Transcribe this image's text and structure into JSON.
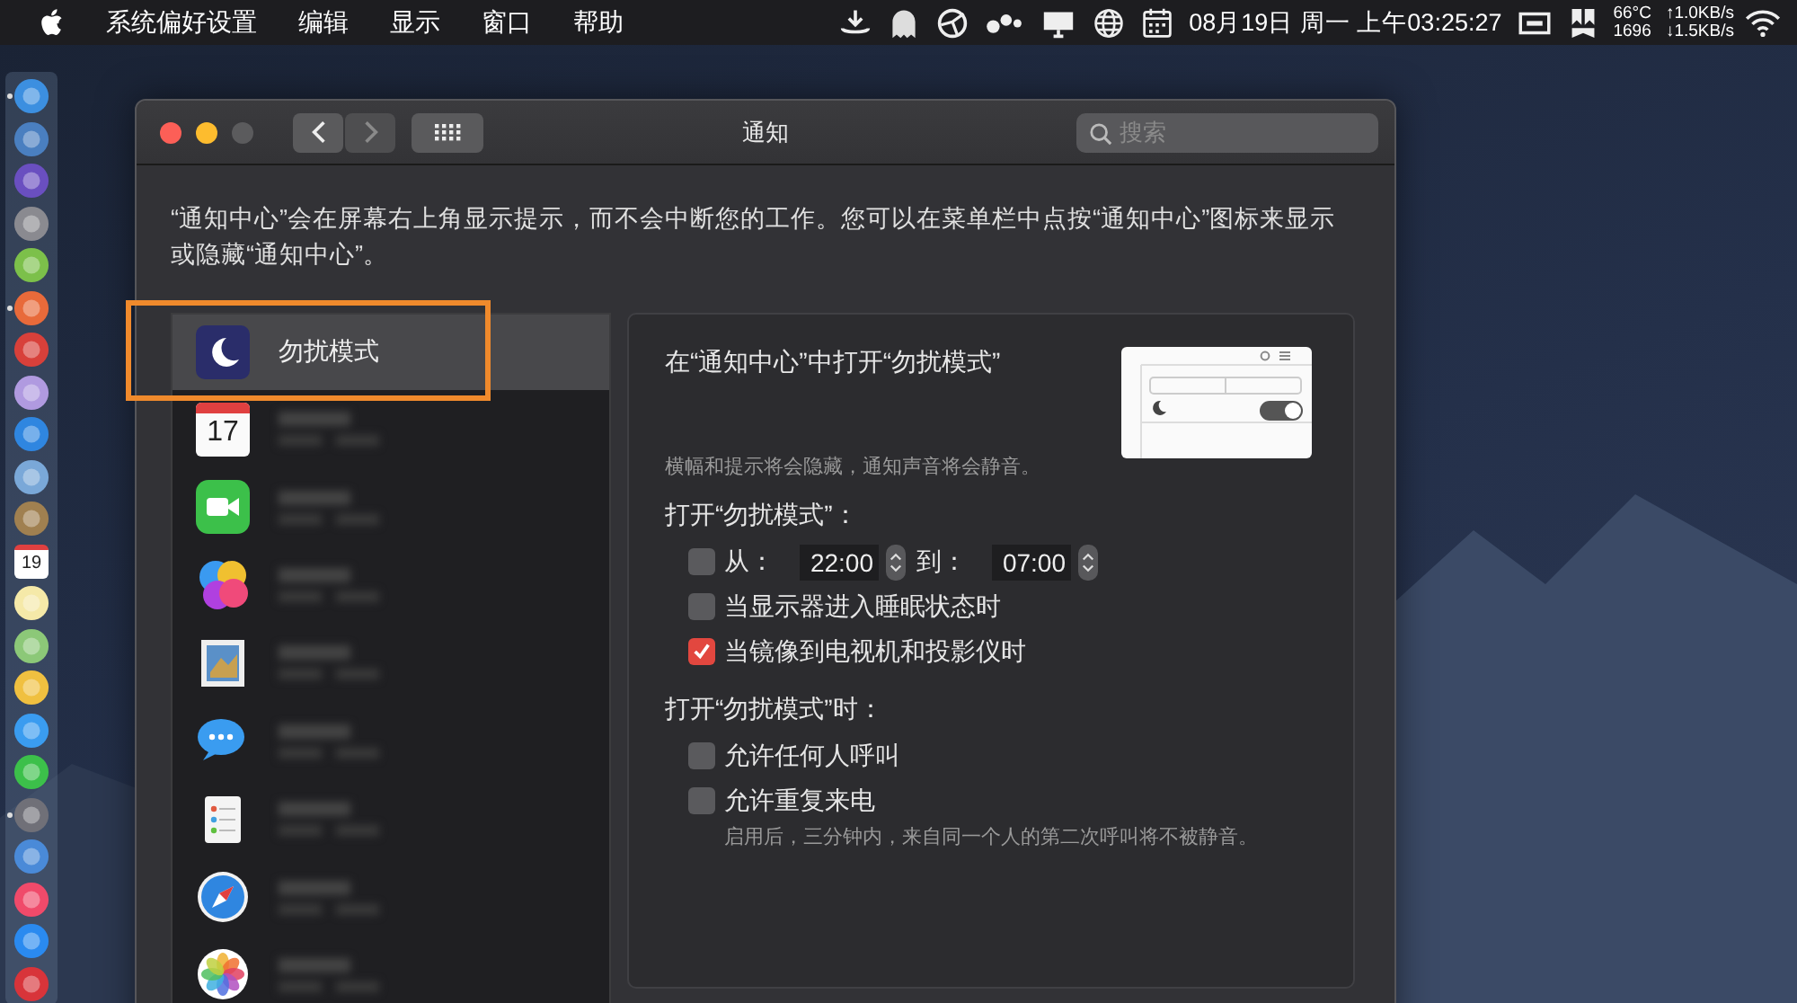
{
  "menu_bar": {
    "app_name": "系统偏好设置",
    "menus": [
      "编辑",
      "显示",
      "窗口",
      "帮助"
    ],
    "clock": "08月19日 周一 上午03:25:27",
    "stats": [
      {
        "label": "66°C",
        "rate": "↑1.0KB/s"
      },
      {
        "label": "1696",
        "rate": "↓1.5KB/s"
      }
    ]
  },
  "dock": [
    {
      "kind": "finder",
      "running": true
    },
    {
      "kind": "compass",
      "running": false
    },
    {
      "kind": "siri",
      "running": false
    },
    {
      "kind": "rocket",
      "running": false
    },
    {
      "kind": "android",
      "running": false
    },
    {
      "kind": "wheel",
      "running": true
    },
    {
      "kind": "red",
      "running": false
    },
    {
      "kind": "purple",
      "running": false
    },
    {
      "kind": "safari",
      "running": false
    },
    {
      "kind": "preview",
      "running": false
    },
    {
      "kind": "notebook",
      "running": false
    },
    {
      "kind": "calendar",
      "day": "19",
      "running": false
    },
    {
      "kind": "notes",
      "running": false
    },
    {
      "kind": "maps",
      "running": false
    },
    {
      "kind": "photos",
      "running": false
    },
    {
      "kind": "messages",
      "running": false
    },
    {
      "kind": "facetime",
      "running": false
    },
    {
      "kind": "settings",
      "running": true
    },
    {
      "kind": "keynote",
      "running": false
    },
    {
      "kind": "music",
      "running": false
    },
    {
      "kind": "appstore",
      "running": false
    },
    {
      "kind": "vivaldi",
      "running": false
    }
  ],
  "window": {
    "title": "通知",
    "search": {
      "placeholder": "搜索"
    },
    "intro": "“通知中心”会在屏幕右上角显示提示，而不会中断您的工作。您可以在菜单栏中点按“通知中心”图标来显示或隐藏“通知中心”。",
    "sidebar": [
      {
        "kind": "dnd",
        "label": "勿扰模式",
        "selected": true,
        "highlighted": true
      },
      {
        "kind": "calendar",
        "day": "17",
        "selected": false,
        "highlighted": false
      },
      {
        "kind": "facetime",
        "selected": false,
        "highlighted": false
      },
      {
        "kind": "gamecenter",
        "selected": false,
        "highlighted": false
      },
      {
        "kind": "preview",
        "selected": false,
        "highlighted": false
      },
      {
        "kind": "messages",
        "selected": false,
        "highlighted": false
      },
      {
        "kind": "reminders",
        "selected": false,
        "highlighted": false
      },
      {
        "kind": "safari",
        "selected": false,
        "highlighted": false
      },
      {
        "kind": "photos",
        "selected": false,
        "highlighted": false
      }
    ],
    "panel": {
      "heading": "在“通知中心”中打开“勿扰模式”",
      "hint": "横幅和提示将会隐藏，通知声音将会静音。",
      "sections": [
        {
          "title": "打开“勿扰模式”：",
          "options": [
            {
              "kind": "schedule",
              "checked": false,
              "from_label": "从：",
              "from": "22:00",
              "to_label": "到：",
              "to": "07:00"
            },
            {
              "kind": "checkbox",
              "checked": false,
              "label": "当显示器进入睡眠状态时"
            },
            {
              "kind": "checkbox",
              "checked": true,
              "label": "当镜像到电视机和投影仪时"
            }
          ]
        },
        {
          "title": "打开“勿扰模式”时：",
          "options": [
            {
              "kind": "checkbox",
              "checked": false,
              "label": "允许任何人呼叫"
            },
            {
              "kind": "checkbox",
              "checked": false,
              "label": "允许重复来电",
              "note": "启用后，三分钟内，来自同一个人的第二次呼叫将不被静音。"
            }
          ]
        }
      ]
    }
  }
}
